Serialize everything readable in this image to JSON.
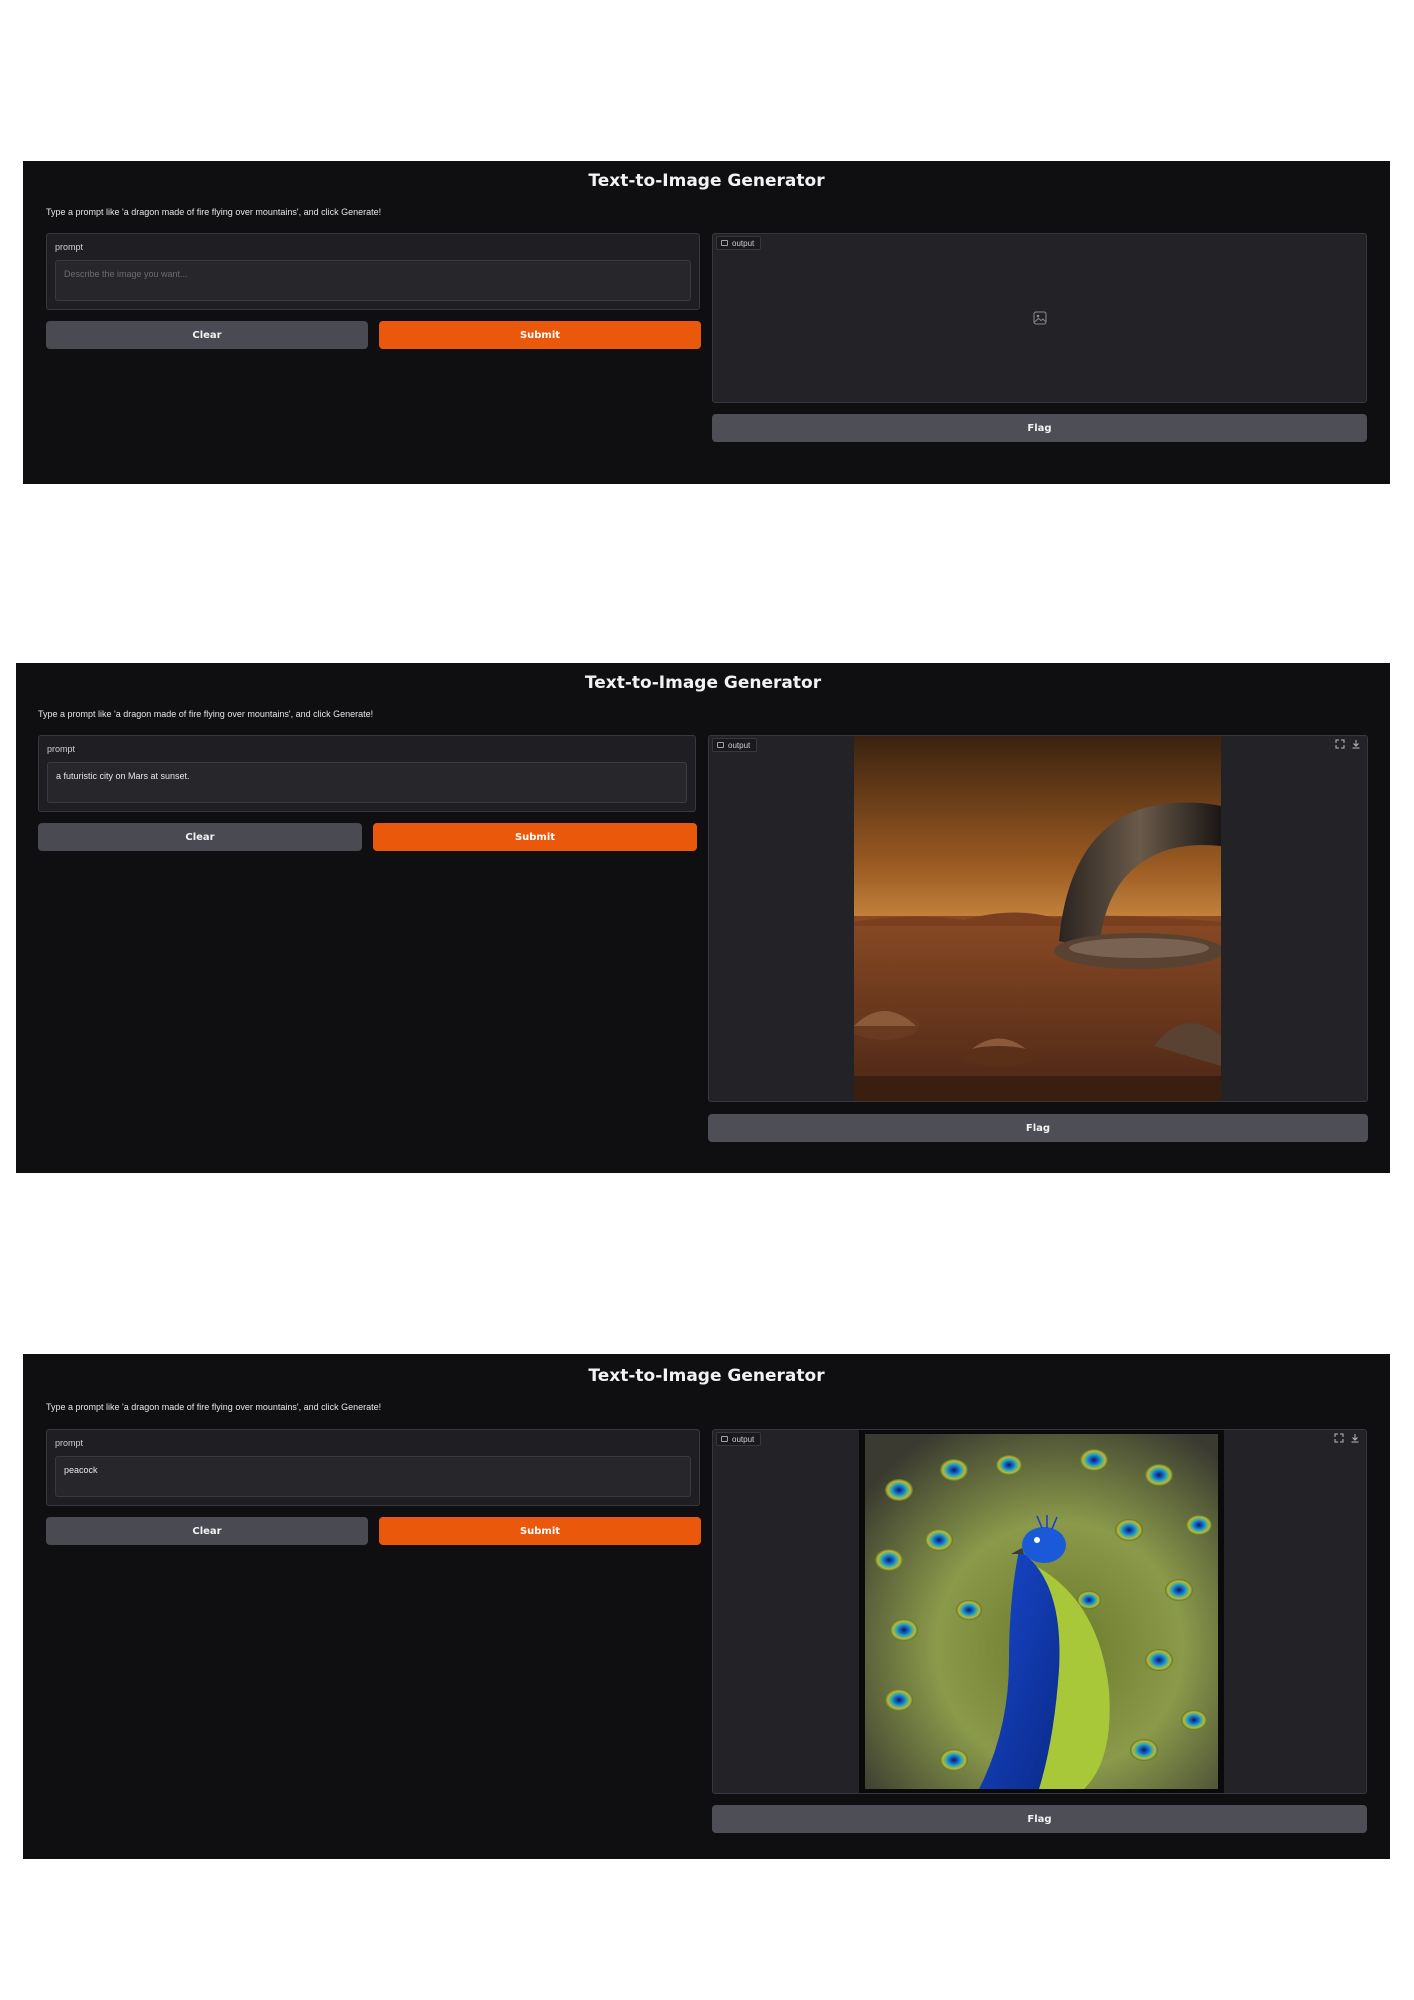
{
  "app": {
    "title": "Text-to-Image Generator",
    "description": "Type a prompt like 'a dragon made of fire flying over mountains', and click Generate!"
  },
  "input": {
    "label": "prompt",
    "placeholder": "Describe the image you want..."
  },
  "buttons": {
    "clear": "Clear",
    "submit": "Submit",
    "flag": "Flag"
  },
  "output": {
    "label": "output"
  },
  "colors": {
    "background": "#0f0f11",
    "submit": "#ea580c",
    "secondary_button": "#4a4a52"
  },
  "icons": [
    "image-icon",
    "image-placeholder-icon",
    "fullscreen-icon",
    "download-icon"
  ],
  "screens": [
    {
      "prompt_value": "",
      "output_state": "empty"
    },
    {
      "prompt_value": "a futuristic city on Mars at sunset.",
      "output_state": "mars city image"
    },
    {
      "prompt_value": "peacock",
      "output_state": "peacock image"
    }
  ]
}
